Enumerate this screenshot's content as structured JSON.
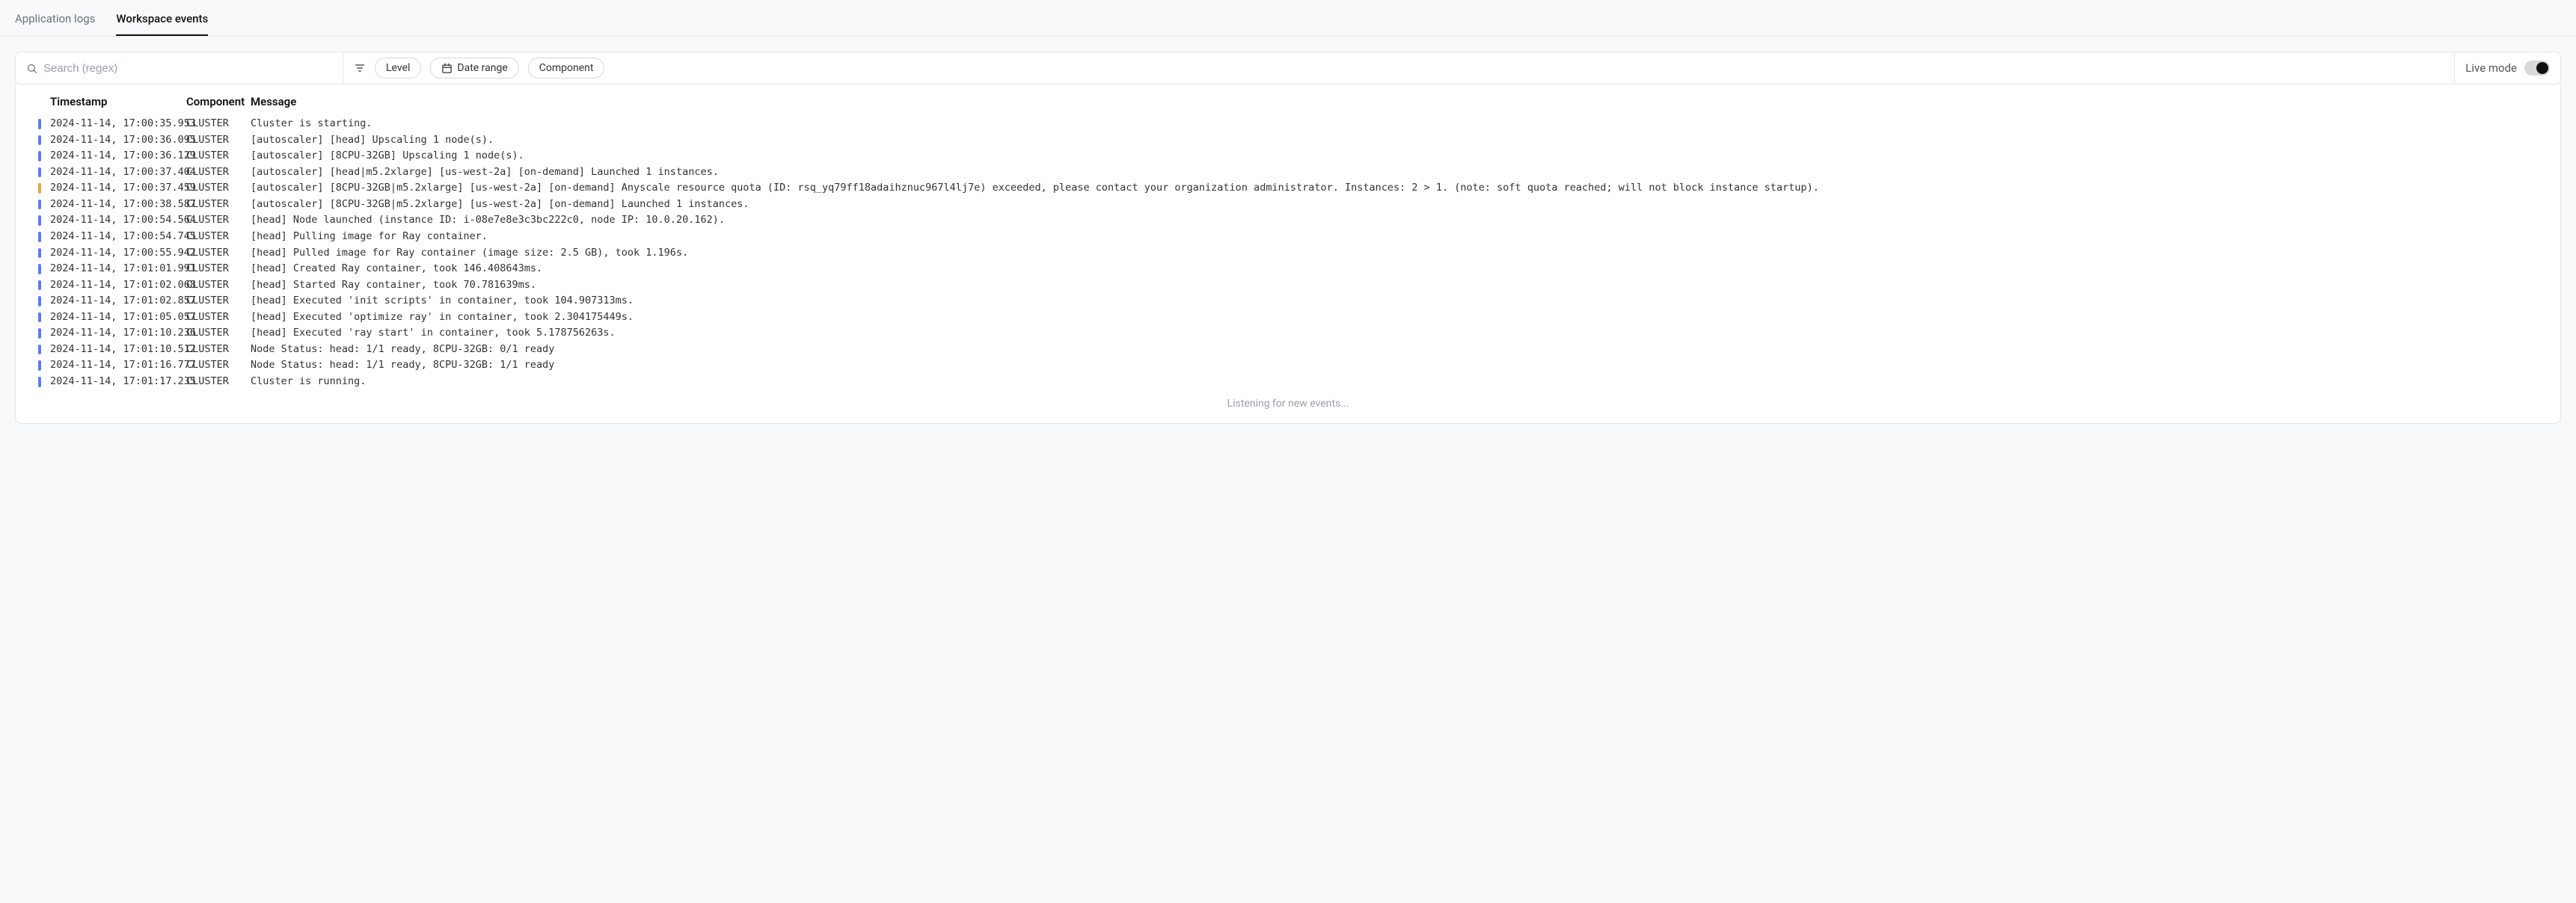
{
  "tabs": [
    {
      "label": "Application logs",
      "active": false
    },
    {
      "label": "Workspace events",
      "active": true
    }
  ],
  "search": {
    "placeholder": "Search (regex)"
  },
  "filters": {
    "level": "Level",
    "date_range": "Date range",
    "component": "Component"
  },
  "live_mode": {
    "label": "Live mode",
    "on": true
  },
  "columns": {
    "timestamp": "Timestamp",
    "component": "Component",
    "message": "Message"
  },
  "logs": [
    {
      "level": "info",
      "timestamp": "2024-11-14, 17:00:35.953",
      "component": "CLUSTER",
      "message": "Cluster is starting."
    },
    {
      "level": "info",
      "timestamp": "2024-11-14, 17:00:36.095",
      "component": "CLUSTER",
      "message": "[autoscaler] [head] Upscaling 1 node(s)."
    },
    {
      "level": "info",
      "timestamp": "2024-11-14, 17:00:36.129",
      "component": "CLUSTER",
      "message": "[autoscaler] [8CPU-32GB] Upscaling 1 node(s)."
    },
    {
      "level": "info",
      "timestamp": "2024-11-14, 17:00:37.404",
      "component": "CLUSTER",
      "message": "[autoscaler] [head|m5.2xlarge] [us-west-2a] [on-demand] Launched 1 instances."
    },
    {
      "level": "warn",
      "timestamp": "2024-11-14, 17:00:37.459",
      "component": "CLUSTER",
      "message": "[autoscaler] [8CPU-32GB|m5.2xlarge] [us-west-2a] [on-demand] Anyscale resource quota (ID: rsq_yq79ff18adaihznuc967l4lj7e) exceeded, please contact your organization administrator. Instances: 2 > 1. (note: soft quota reached; will not block instance startup)."
    },
    {
      "level": "info",
      "timestamp": "2024-11-14, 17:00:38.587",
      "component": "CLUSTER",
      "message": "[autoscaler] [8CPU-32GB|m5.2xlarge] [us-west-2a] [on-demand] Launched 1 instances."
    },
    {
      "level": "info",
      "timestamp": "2024-11-14, 17:00:54.564",
      "component": "CLUSTER",
      "message": "[head] Node launched (instance ID: i-08e7e8e3c3bc222c0, node IP: 10.0.20.162)."
    },
    {
      "level": "info",
      "timestamp": "2024-11-14, 17:00:54.745",
      "component": "CLUSTER",
      "message": "[head] Pulling image for Ray container."
    },
    {
      "level": "info",
      "timestamp": "2024-11-14, 17:00:55.942",
      "component": "CLUSTER",
      "message": "[head] Pulled image for Ray container (image size: 2.5 GB), took 1.196s."
    },
    {
      "level": "info",
      "timestamp": "2024-11-14, 17:01:01.991",
      "component": "CLUSTER",
      "message": "[head] Created Ray container, took 146.408643ms."
    },
    {
      "level": "info",
      "timestamp": "2024-11-14, 17:01:02.068",
      "component": "CLUSTER",
      "message": "[head] Started Ray container, took 70.781639ms."
    },
    {
      "level": "info",
      "timestamp": "2024-11-14, 17:01:02.857",
      "component": "CLUSTER",
      "message": "[head] Executed 'init scripts' in container, took 104.907313ms."
    },
    {
      "level": "info",
      "timestamp": "2024-11-14, 17:01:05.057",
      "component": "CLUSTER",
      "message": "[head] Executed 'optimize ray' in container, took 2.304175449s."
    },
    {
      "level": "info",
      "timestamp": "2024-11-14, 17:01:10.236",
      "component": "CLUSTER",
      "message": "[head] Executed 'ray start' in container, took 5.178756263s."
    },
    {
      "level": "info",
      "timestamp": "2024-11-14, 17:01:10.512",
      "component": "CLUSTER",
      "message": "Node Status: head: 1/1 ready, 8CPU-32GB: 0/1 ready"
    },
    {
      "level": "info",
      "timestamp": "2024-11-14, 17:01:16.777",
      "component": "CLUSTER",
      "message": "Node Status: head: 1/1 ready, 8CPU-32GB: 1/1 ready"
    },
    {
      "level": "info",
      "timestamp": "2024-11-14, 17:01:17.235",
      "component": "CLUSTER",
      "message": "Cluster is running."
    }
  ],
  "listening": "Listening for new events..."
}
